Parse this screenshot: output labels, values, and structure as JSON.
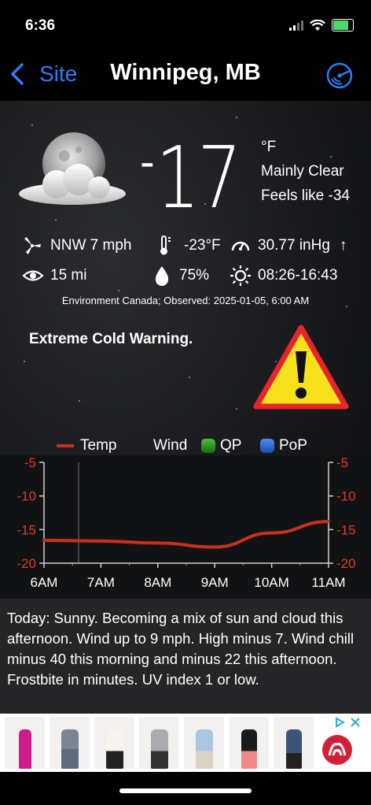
{
  "status_bar": {
    "time": "6:36"
  },
  "nav": {
    "back_label": "Site",
    "title": "Winnipeg, MB",
    "back_icon": "chevron-left-icon",
    "radar_icon": "radar-icon"
  },
  "current": {
    "temp_sign": "-",
    "temperature": "17",
    "unit": "°F",
    "condition": "Mainly Clear",
    "feels_like": "Feels like -34",
    "condition_icon": "moon-cloud-icon"
  },
  "details": {
    "wind": "NNW 7 mph",
    "dewpoint": "-23°F",
    "pressure": "30.77 inHg",
    "pressure_trend": "↑",
    "visibility": "15 mi",
    "humidity": "75%",
    "sunrise_sunset": "08:26-16:43"
  },
  "source": "Environment Canada; Observed: 2025-01-05, 6:00 AM",
  "warning": {
    "text": "Extreme Cold Warning.",
    "icon": "warning-icon"
  },
  "legend": {
    "temp": "Temp",
    "wind": "Wind",
    "qp": "QP",
    "pop": "PoP"
  },
  "colors": {
    "accent": "#2e7cf6",
    "temp_line": "#c9301c",
    "qp": "#3aa12c",
    "pop": "#2d6fd6",
    "warning_yellow": "#f7e01c",
    "warning_red": "#e6242a"
  },
  "chart_data": {
    "type": "line",
    "categories": [
      "6AM",
      "7AM",
      "8AM",
      "9AM",
      "10AM",
      "11AM"
    ],
    "series": [
      {
        "name": "Temp",
        "values": [
          -16.6,
          -16.7,
          -17.0,
          -17.6,
          -15.5,
          -13.8
        ]
      }
    ],
    "y_ticks": [
      "-5",
      "-10",
      "-15",
      "-20"
    ],
    "ylim": [
      -20,
      -5
    ]
  },
  "forecast": {
    "text": "Today:  Sunny. Becoming a mix of sun and cloud this afternoon. Wind up to 9 mph. High minus 7. Wind chill minus 40 this morning and minus 22 this afternoon. Frostbite in minutes. UV index 1 or low."
  }
}
